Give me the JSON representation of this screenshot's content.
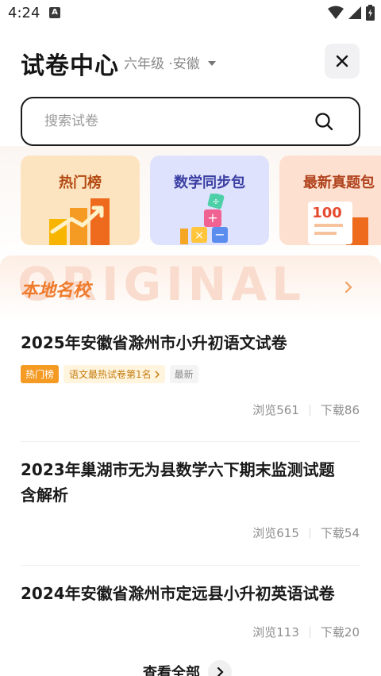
{
  "status_bar": {
    "time": "4:24",
    "notification_glyph": "A",
    "icons": [
      "wifi-icon",
      "signal-icon",
      "battery-charging-icon"
    ]
  },
  "header": {
    "title": "试卷中心",
    "region": "六年级 ·安徽",
    "close_icon": "close-icon"
  },
  "search": {
    "placeholder": "搜索试卷",
    "icon": "search-icon"
  },
  "category_cards": [
    {
      "label": "热门榜",
      "icon": "trending-chart-icon",
      "color": "#fde4c0"
    },
    {
      "label": "数学同步包",
      "icon": "math-blocks-icon",
      "color": "#dfe2fc"
    },
    {
      "label": "最新真题包",
      "icon": "score-100-icon",
      "color": "#fde0cf"
    }
  ],
  "section": {
    "watermark": "ORIGINAL",
    "title": "本地名校",
    "arrow_icon": "chevron-right-icon",
    "accent": "#ef7b2c"
  },
  "papers": [
    {
      "title": "2025年安徽省滁州市小升初语文试卷",
      "tags": {
        "hot": "热门榜",
        "rank": "语文最热试卷第1名",
        "new": "最新"
      },
      "views": "浏览561",
      "downloads": "下载86"
    },
    {
      "title_line1": "2023年巢湖市无为县数学六下期末监测试题",
      "title_line2": "含解析",
      "views": "浏览615",
      "downloads": "下载54"
    },
    {
      "title": "2024年安徽省滁州市定远县小升初英语试卷",
      "views": "浏览113",
      "downloads": "下载20"
    }
  ],
  "footer": {
    "more_label": "查看全部"
  }
}
